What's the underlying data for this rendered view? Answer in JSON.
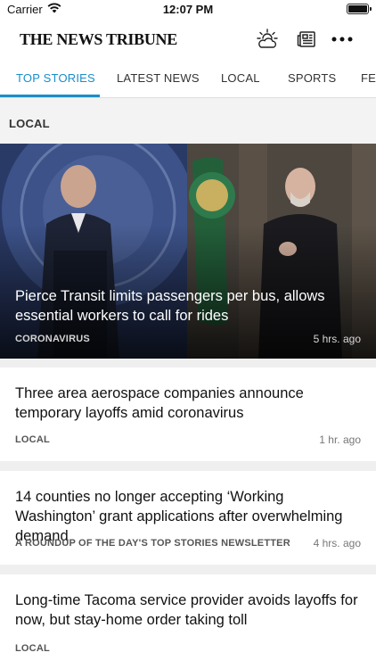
{
  "status_bar": {
    "carrier": "Carrier",
    "time": "12:07 PM",
    "icons": [
      "wifi-icon",
      "battery-icon"
    ]
  },
  "header": {
    "masthead": "THE NEWS TRIBUNE",
    "icons": [
      "weather-icon",
      "e-edition-icon",
      "more-icon"
    ]
  },
  "tabs": [
    {
      "label": "TOP STORIES",
      "active": true
    },
    {
      "label": "LATEST NEWS",
      "active": false
    },
    {
      "label": "LOCAL",
      "active": false
    },
    {
      "label": "SPORTS",
      "active": false
    },
    {
      "label": "FE",
      "active": false
    }
  ],
  "section": {
    "title": "LOCAL"
  },
  "hero": {
    "headline": "Pierce Transit limits passengers per bus, allows essential workers to call for rides",
    "category": "CORONAVIRUS",
    "time": "5 hrs. ago"
  },
  "stories": [
    {
      "headline": "Three area aerospace companies announce temporary layoffs amid coronavirus",
      "category": "LOCAL",
      "time": "1 hr. ago"
    },
    {
      "headline": "14 counties no longer accepting ‘Working Washington’ grant applications after overwhelming demand",
      "category": "A ROUNDUP OF THE DAY'S TOP STORIES NEWSLETTER",
      "time": "4 hrs. ago"
    },
    {
      "headline": "Long-time Tacoma service provider avoids layoffs for now, but stay-home order taking toll",
      "category": "LOCAL",
      "time": ""
    }
  ],
  "colors": {
    "accent": "#1a8ec9",
    "background": "#efefef",
    "card": "#ffffff"
  }
}
